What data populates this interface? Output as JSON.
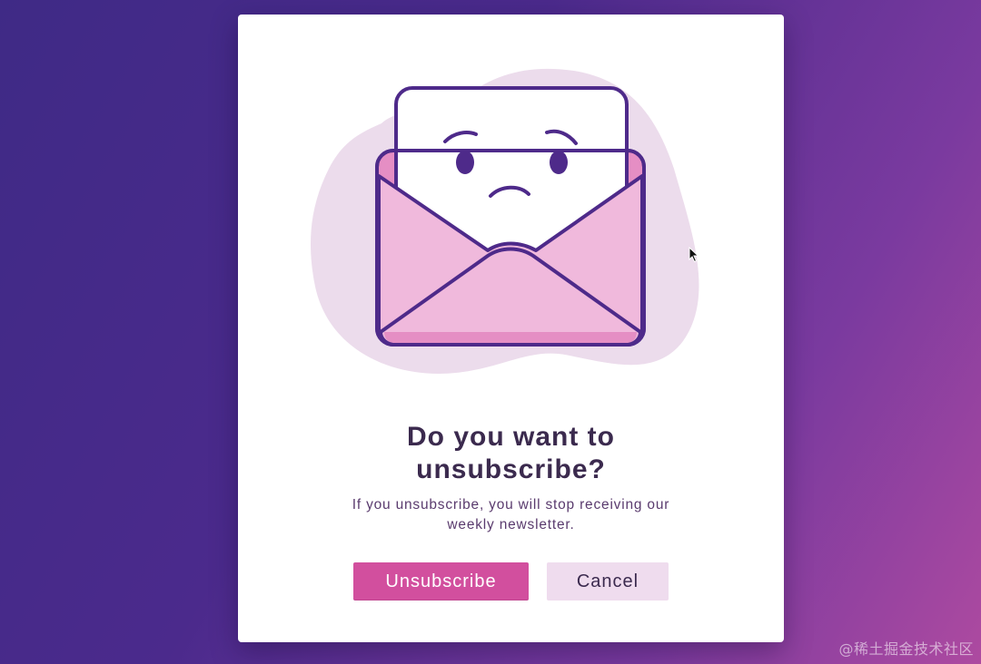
{
  "dialog": {
    "title_line1": "Do you want to",
    "title_line2": "unsubscribe?",
    "message_line1": "If you unsubscribe, you will stop receiving our",
    "message_line2": "weekly newsletter.",
    "primary_label": "Unsubscribe",
    "secondary_label": "Cancel",
    "illustration_icon": "sad-envelope-icon"
  },
  "watermark": "@稀土掘金技术社区",
  "colors": {
    "accent": "#d24f9e",
    "secondary_bg": "#efdcee",
    "title_text": "#3b2a4e",
    "outline": "#4e2a8a",
    "envelope_pink": "#f0b9dc",
    "blob": "#ecdcec"
  }
}
